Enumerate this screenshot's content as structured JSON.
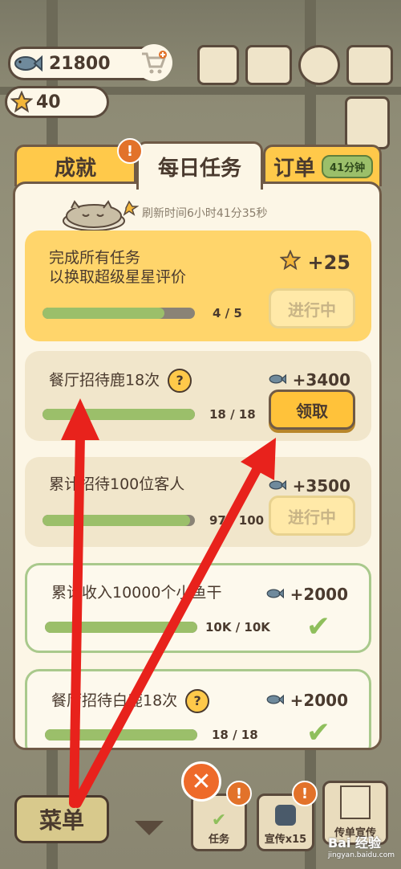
{
  "currency": {
    "fish": "21800",
    "stars": "40"
  },
  "tabs": {
    "achievements": "成就",
    "daily": "每日任务",
    "orders": "订单",
    "orders_timer": "41分钟",
    "badge": "!"
  },
  "refresh_text": "刷新时间6小时41分35秒",
  "tasks": [
    {
      "title_line1": "完成所有任务",
      "title_line2": "以换取超级星星评价",
      "reward": "+25",
      "progress_text": "4  /  5",
      "progress": 0.8,
      "button": "进行中"
    },
    {
      "title": "餐厅招待鹿18次",
      "help": "?",
      "reward": "+3400",
      "progress_text": "18  /  18",
      "progress": 1.0,
      "button": "领取"
    },
    {
      "title": "累计招待100位客人",
      "reward": "+3500",
      "progress_text": "97  /  100",
      "progress": 0.97,
      "button": "进行中"
    },
    {
      "title": "累计收入10000个小鱼干",
      "reward": "+2000",
      "progress_text": "10K  /  10K",
      "progress": 1.0,
      "check": "✔"
    },
    {
      "title": "餐厅招待白鹿18次",
      "help": "?",
      "reward": "+2000",
      "progress_text": "18  /  18",
      "progress": 1.0,
      "check": "✔"
    }
  ],
  "bottom": {
    "menu": "菜单",
    "close": "✕",
    "tasks_label": "任务",
    "promo_label": "宣传x15",
    "flyer_label": "传单宣传"
  },
  "watermark": {
    "brand": "Bai 经验",
    "url": "jingyan.baidu.com"
  },
  "colors": {
    "gold": "#ffd56b",
    "accent_orange": "#ee6a2a",
    "progress_green": "#9bbf6a",
    "arrow_red": "#e8221c"
  }
}
